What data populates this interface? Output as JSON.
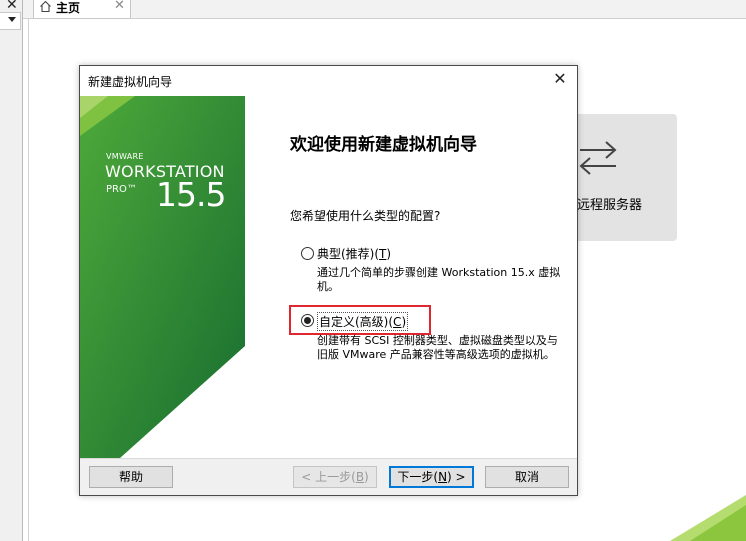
{
  "left_panel": {
    "close_glyph": "✕",
    "dropdown_icon": "chevron-down-icon"
  },
  "tabs": [
    {
      "label": "主页",
      "icon": "home-icon",
      "close_glyph": "✕"
    }
  ],
  "remote_server": {
    "label": "远程服务器",
    "icon": "arrows-exchange-icon"
  },
  "dialog": {
    "title": "新建虚拟机向导",
    "close_glyph": "✕",
    "banner": {
      "vmware": "VMWARE",
      "workstation": "WORKSTATION",
      "pro": "PRO™",
      "version": "15.5"
    },
    "heading": "欢迎使用新建虚拟机向导",
    "question": "您希望使用什么类型的配置?",
    "options": [
      {
        "label_prefix": "典型(推荐)(",
        "mnemonic": "T",
        "label_suffix": ")",
        "description": "通过几个简单的步骤创建 Workstation 15.x 虚拟机。",
        "selected": false
      },
      {
        "label_prefix": "自定义(高级)(",
        "mnemonic": "C",
        "label_suffix": ")",
        "description": "创建带有 SCSI 控制器类型、虚拟磁盘类型以及与旧版 VMware 产品兼容性等高级选项的虚拟机。",
        "selected": true
      }
    ],
    "buttons": {
      "help": "帮助",
      "back_prefix": "< 上一步(",
      "back_mnemonic": "B",
      "back_suffix": ")",
      "next_prefix": "下一步(",
      "next_mnemonic": "N",
      "next_suffix": ") >",
      "cancel": "取消"
    }
  },
  "colors": {
    "banner_green_dark": "#1f7a35",
    "banner_green_light": "#4fae3a",
    "highlight_red": "#e0262e",
    "default_button_border": "#0078d7"
  }
}
